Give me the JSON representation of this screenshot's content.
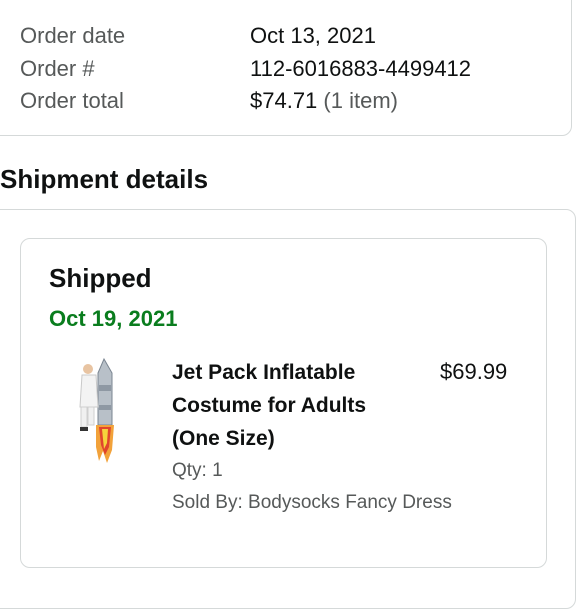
{
  "order_summary": {
    "order_date_label": "Order date",
    "order_date_value": "Oct 13, 2021",
    "order_number_label": "Order #",
    "order_number_value": "112-6016883-4499412",
    "order_total_label": "Order total",
    "order_total_value": "$74.71",
    "order_total_items": "(1 item)"
  },
  "shipment": {
    "section_title": "Shipment details",
    "status": "Shipped",
    "date": "Oct 19, 2021",
    "item": {
      "image_icon": "jet-pack-costume-product-image",
      "title": "Jet Pack Inflatable Costume for Adults (One Size)",
      "price": "$69.99",
      "qty": "Qty: 1",
      "seller": "Sold By: Bodysocks Fancy Dress"
    }
  },
  "colors": {
    "shipped_date": "#0a7d1e",
    "border": "#d5d9d9",
    "muted_text": "#565959"
  }
}
